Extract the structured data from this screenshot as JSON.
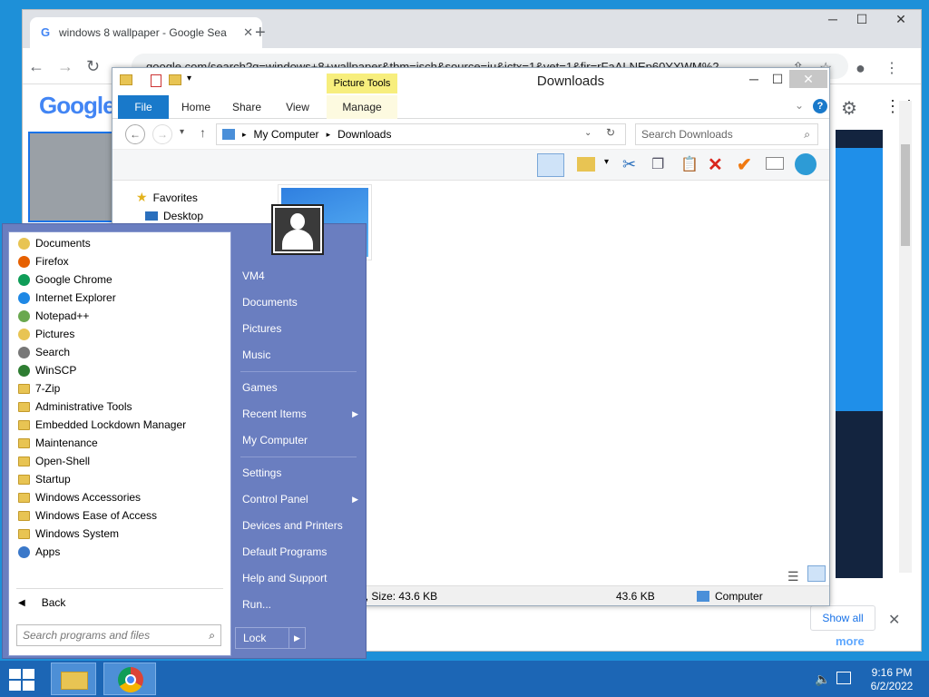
{
  "chrome": {
    "tab_title": "windows 8 wallpaper - Google Sea",
    "url": "google.com/search?q=windows+8+wallpaper&tbm=isch&source=iu&ictx=1&vet=1&fir=rFaALNEp60YXWM%2",
    "logo": "Google",
    "show_all": "Show all",
    "more_text": "more"
  },
  "explorer": {
    "qat_label": "Picture Tools",
    "title": "Downloads",
    "tabs": [
      "File",
      "Home",
      "Share",
      "View",
      "Manage"
    ],
    "breadcrumb": [
      "My Computer",
      "Downloads"
    ],
    "search_placeholder": "Search Downloads",
    "nav": {
      "favorites": "Favorites",
      "desktop": "Desktop"
    },
    "status_details": "Dimensions: 1200 x 800, Size: 43.6 KB",
    "status_size": "43.6 KB",
    "status_location": "Computer"
  },
  "startmenu": {
    "programs": [
      {
        "label": "Documents",
        "icon": "documents-icon"
      },
      {
        "label": "Firefox",
        "icon": "firefox-icon"
      },
      {
        "label": "Google Chrome",
        "icon": "chrome-icon"
      },
      {
        "label": "Internet Explorer",
        "icon": "ie-icon"
      },
      {
        "label": "Notepad++",
        "icon": "notepad-icon"
      },
      {
        "label": "Pictures",
        "icon": "pictures-icon"
      },
      {
        "label": "Search",
        "icon": "search-icon"
      },
      {
        "label": "WinSCP",
        "icon": "winscp-icon"
      },
      {
        "label": "7-Zip",
        "icon": "folder-icon"
      },
      {
        "label": "Administrative Tools",
        "icon": "folder-icon"
      },
      {
        "label": "Embedded Lockdown Manager",
        "icon": "folder-icon"
      },
      {
        "label": "Maintenance",
        "icon": "folder-icon"
      },
      {
        "label": "Open-Shell",
        "icon": "folder-icon"
      },
      {
        "label": "Startup",
        "icon": "folder-icon"
      },
      {
        "label": "Windows Accessories",
        "icon": "folder-icon"
      },
      {
        "label": "Windows Ease of Access",
        "icon": "folder-icon"
      },
      {
        "label": "Windows System",
        "icon": "folder-icon"
      },
      {
        "label": "Apps",
        "icon": "apps-icon"
      }
    ],
    "back": "Back",
    "search_placeholder": "Search programs and files",
    "user": "VM4",
    "right": {
      "documents": "Documents",
      "pictures": "Pictures",
      "music": "Music",
      "games": "Games",
      "recent": "Recent Items",
      "computer": "My Computer",
      "settings": "Settings",
      "control": "Control Panel",
      "devices": "Devices and Printers",
      "defaults": "Default Programs",
      "help": "Help and Support",
      "run": "Run..."
    },
    "lock": "Lock"
  },
  "taskbar": {
    "time": "9:16 PM",
    "date": "6/2/2022"
  },
  "colors": {
    "accent": "#1c66b5",
    "startmenu": "#6a7ec0",
    "ribbon_file": "#1979ca",
    "picture_tools": "#f7ee7d"
  }
}
